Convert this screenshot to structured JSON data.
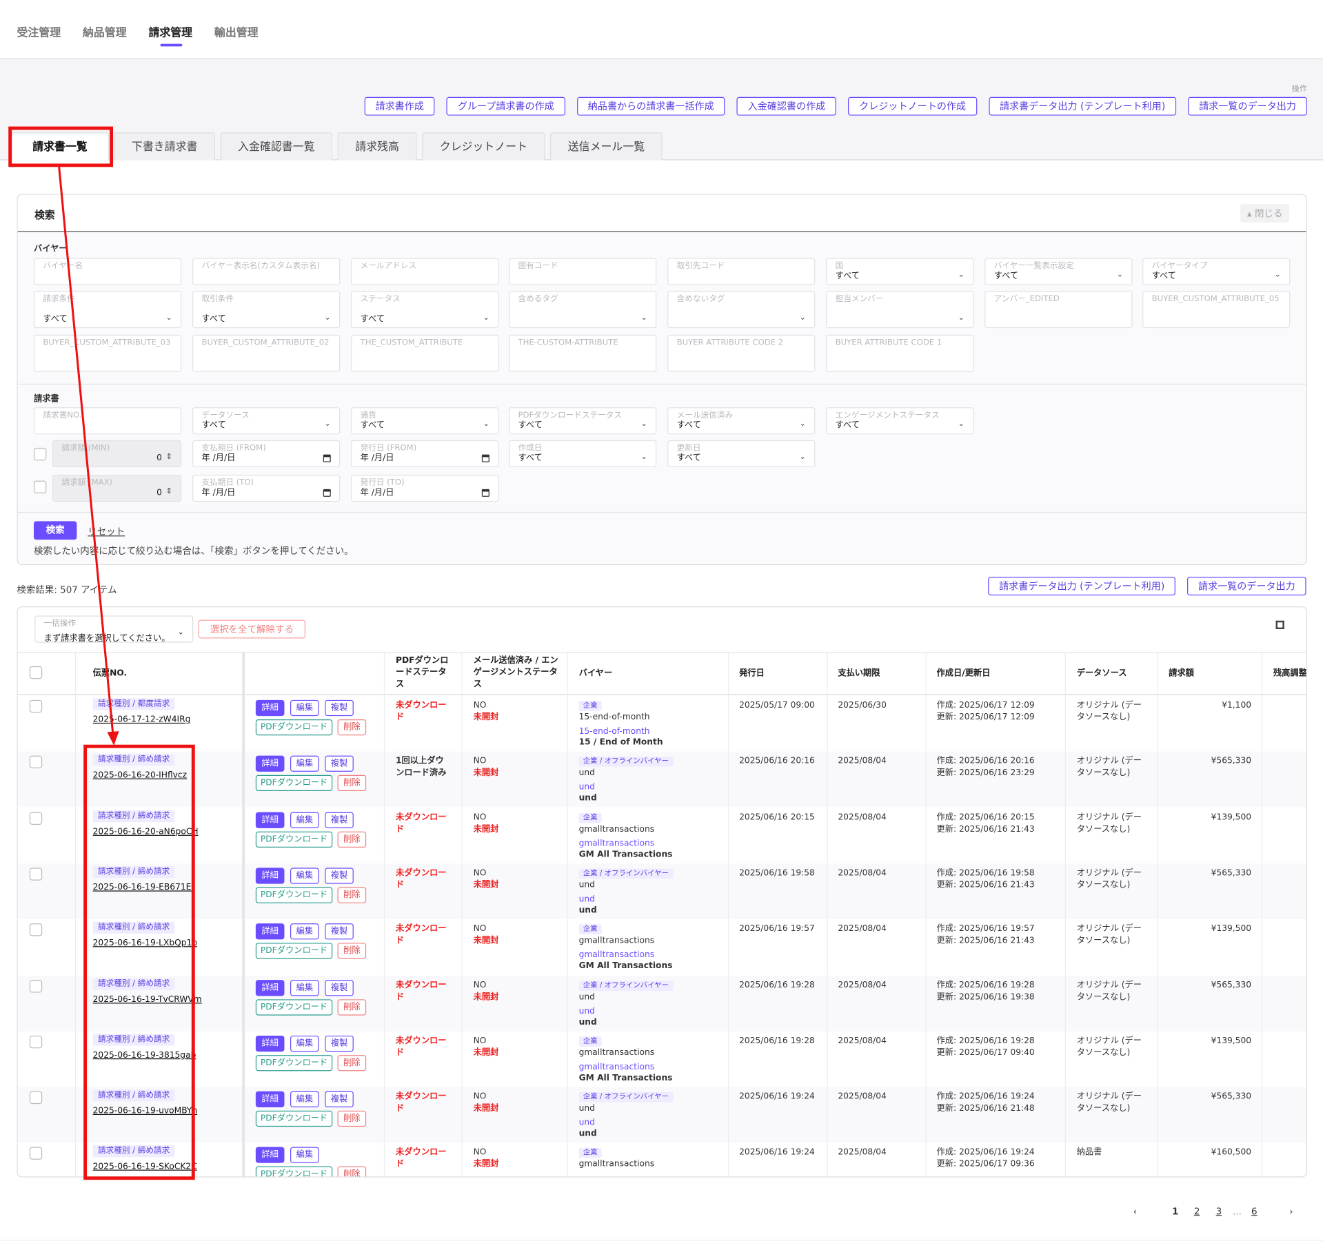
{
  "topnav": [
    "受注管理",
    "納品管理",
    "請求管理",
    "輸出管理"
  ],
  "ops_label": "操作",
  "ops": [
    "請求書作成",
    "グループ請求書の作成",
    "納品書からの請求書一括作成",
    "入金確認書の作成",
    "クレジットノートの作成",
    "請求書データ出力 (テンプレート利用)",
    "請求一覧のデータ出力"
  ],
  "tabs": [
    "請求書一覧",
    "下書き請求書",
    "入金確認書一覧",
    "請求残高",
    "クレジットノート",
    "送信メール一覧"
  ],
  "search": {
    "title": "検索",
    "close": "閉じる",
    "buyer_label": "バイヤー",
    "invoice_label": "請求書",
    "buyer_fields": [
      {
        "label": "バイヤー名",
        "value": ""
      },
      {
        "label": "バイヤー表示名(カスタム表示名)",
        "value": ""
      },
      {
        "label": "メールアドレス",
        "value": ""
      },
      {
        "label": "固有コード",
        "value": ""
      },
      {
        "label": "取引先コード",
        "value": ""
      },
      {
        "label": "国",
        "value": "すべて"
      },
      {
        "label": "バイヤー一覧表示設定",
        "value": "すべて"
      },
      {
        "label": "バイヤータイプ",
        "value": "すべて"
      },
      {
        "label": "請求条件",
        "value": "すべて"
      },
      {
        "label": "取引条件",
        "value": "すべて"
      },
      {
        "label": "ステータス",
        "value": "すべて"
      },
      {
        "label": "含めるタグ",
        "value": ""
      },
      {
        "label": "含めないタグ",
        "value": ""
      },
      {
        "label": "担当メンバー",
        "value": ""
      },
      {
        "label": "アンバー_EDITED",
        "value": ""
      },
      {
        "label": "BUYER_CUSTOM_ATTRIBUTE_05",
        "value": ""
      },
      {
        "label": "BUYER_CUSTOM_ATTRIBUTE_03",
        "value": ""
      },
      {
        "label": "BUYER_CUSTOM_ATTRIBUTE_02",
        "value": ""
      },
      {
        "label": "THE_CUSTOM_ATTRIBUTE",
        "value": ""
      },
      {
        "label": "THE-CUSTOM-ATTRIBUTE",
        "value": ""
      },
      {
        "label": "BUYER ATTRIBUTE CODE 2",
        "value": ""
      },
      {
        "label": "BUYER ATTRIBUTE CODE 1",
        "value": ""
      }
    ],
    "invoice_fields": [
      {
        "label": "請求書NO.",
        "value": ""
      },
      {
        "label": "データソース",
        "value": "すべて"
      },
      {
        "label": "通貨",
        "value": "すべて"
      },
      {
        "label": "PDFダウンロードステータス",
        "value": "すべて"
      },
      {
        "label": "メール送信済み",
        "value": "すべて"
      },
      {
        "label": "エンゲージメントステータス",
        "value": "すべて"
      },
      {
        "label": "請求額 (MIN)",
        "value": "0"
      },
      {
        "label": "支払期日 (FROM)",
        "value": "年 /月/日"
      },
      {
        "label": "発行日 (FROM)",
        "value": "年 /月/日"
      },
      {
        "label": "作成日",
        "value": "すべて"
      },
      {
        "label": "更新日",
        "value": "すべて"
      },
      {
        "label": "請求額 (MAX)",
        "value": "0"
      },
      {
        "label": "支払期日 (TO)",
        "value": "年 /月/日"
      },
      {
        "label": "発行日 (TO)",
        "value": "年 /月/日"
      }
    ],
    "search_btn": "検索",
    "reset": "リセット",
    "hint": "検索したい内容に応じて絞り込む場合は、「検索」ボタンを押してください。"
  },
  "result_count": "検索結果: 507 アイテム",
  "export_buttons": [
    "請求書データ出力 (テンプレート利用)",
    "請求一覧のデータ出力"
  ],
  "bulk": {
    "label": "一括操作",
    "value": "まず請求書を選択してください。",
    "clear": "選択を全て解除する"
  },
  "columns": [
    "伝票NO.",
    "PDFダウンロードステータス",
    "メール送信済み / エンゲージメントステータス",
    "バイヤー",
    "発行日",
    "支払い期限",
    "作成日/更新日",
    "データソース",
    "請求額",
    "残高調整"
  ],
  "action_labels": {
    "detail": "詳細",
    "edit": "編集",
    "copy": "複製",
    "pdf": "PDFダウンロード",
    "delete": "削除"
  },
  "rows": [
    {
      "type": "請求種別 / 都度請求",
      "no": "2025-06-17-12-zW4IRg",
      "pdf": "未ダウンロード",
      "mail": "NO",
      "engage": "未開封",
      "tag": "企業",
      "buyer": "15-end-of-month",
      "buyer_link": "15-end-of-month",
      "buyer_bold": "15 / End of Month",
      "issue": "2025/05/17 09:00",
      "due": "2025/06/30",
      "created": "作成: 2025/06/17 12:09",
      "updated": "更新: 2025/06/17 12:09",
      "source": "オリジナル (データソースなし)",
      "amount": "¥1,100"
    },
    {
      "type": "請求種別 / 締め請求",
      "no": "2025-06-16-20-IHflvcz",
      "pdf": "1回以上ダウンロード済み",
      "mail": "NO",
      "engage": "未開封",
      "tag": "企業 / オフラインバイヤー",
      "buyer": "und",
      "buyer_link": "und",
      "buyer_bold": "und",
      "issue": "2025/06/16 20:16",
      "due": "2025/08/04",
      "created": "作成: 2025/06/16 20:16",
      "updated": "更新: 2025/06/16 23:29",
      "source": "オリジナル (データソースなし)",
      "amount": "¥565,330"
    },
    {
      "type": "請求種別 / 締め請求",
      "no": "2025-06-16-20-aN6poCH",
      "pdf": "未ダウンロード",
      "mail": "NO",
      "engage": "未開封",
      "tag": "企業",
      "buyer": "gmalltransactions",
      "buyer_link": "gmalltransactions",
      "buyer_bold": "GM All Transactions",
      "issue": "2025/06/16 20:15",
      "due": "2025/08/04",
      "created": "作成: 2025/06/16 20:15",
      "updated": "更新: 2025/06/16 21:43",
      "source": "オリジナル (データソースなし)",
      "amount": "¥139,500"
    },
    {
      "type": "請求種別 / 締め請求",
      "no": "2025-06-16-19-EB671Ef",
      "pdf": "未ダウンロード",
      "mail": "NO",
      "engage": "未開封",
      "tag": "企業 / オフラインバイヤー",
      "buyer": "und",
      "buyer_link": "und",
      "buyer_bold": "und",
      "issue": "2025/06/16 19:58",
      "due": "2025/08/04",
      "created": "作成: 2025/06/16 19:58",
      "updated": "更新: 2025/06/16 21:43",
      "source": "オリジナル (データソースなし)",
      "amount": "¥565,330"
    },
    {
      "type": "請求種別 / 締め請求",
      "no": "2025-06-16-19-LXbQp1p",
      "pdf": "未ダウンロード",
      "mail": "NO",
      "engage": "未開封",
      "tag": "企業",
      "buyer": "gmalltransactions",
      "buyer_link": "gmalltransactions",
      "buyer_bold": "GM All Transactions",
      "issue": "2025/06/16 19:57",
      "due": "2025/08/04",
      "created": "作成: 2025/06/16 19:57",
      "updated": "更新: 2025/06/16 21:43",
      "source": "オリジナル (データソースなし)",
      "amount": "¥139,500"
    },
    {
      "type": "請求種別 / 締め請求",
      "no": "2025-06-16-19-TvCRWVm",
      "pdf": "未ダウンロード",
      "mail": "NO",
      "engage": "未開封",
      "tag": "企業 / オフラインバイヤー",
      "buyer": "und",
      "buyer_link": "und",
      "buyer_bold": "und",
      "issue": "2025/06/16 19:28",
      "due": "2025/08/04",
      "created": "作成: 2025/06/16 19:28",
      "updated": "更新: 2025/06/16 19:38",
      "source": "オリジナル (データソースなし)",
      "amount": "¥565,330"
    },
    {
      "type": "請求種別 / 締め請求",
      "no": "2025-06-16-19-3815gab",
      "pdf": "未ダウンロード",
      "mail": "NO",
      "engage": "未開封",
      "tag": "企業",
      "buyer": "gmalltransactions",
      "buyer_link": "gmalltransactions",
      "buyer_bold": "GM All Transactions",
      "issue": "2025/06/16 19:28",
      "due": "2025/08/04",
      "created": "作成: 2025/06/16 19:28",
      "updated": "更新: 2025/06/17 09:40",
      "source": "オリジナル (データソースなし)",
      "amount": "¥139,500"
    },
    {
      "type": "請求種別 / 締め請求",
      "no": "2025-06-16-19-uvoMBYh",
      "pdf": "未ダウンロード",
      "mail": "NO",
      "engage": "未開封",
      "tag": "企業 / オフラインバイヤー",
      "buyer": "und",
      "buyer_link": "und",
      "buyer_bold": "und",
      "issue": "2025/06/16 19:24",
      "due": "2025/08/04",
      "created": "作成: 2025/06/16 19:24",
      "updated": "更新: 2025/06/16 21:48",
      "source": "オリジナル (データソースなし)",
      "amount": "¥565,330"
    },
    {
      "type": "請求種別 / 締め請求",
      "no": "2025-06-16-19-SKoCK2C",
      "pdf": "未ダウンロード",
      "mail": "NO",
      "engage": "未開封",
      "tag": "企業",
      "buyer": "gmalltransactions",
      "buyer_link": "",
      "buyer_bold": "",
      "issue": "2025/06/16 19:24",
      "due": "2025/08/04",
      "created": "作成: 2025/06/16 19:24",
      "updated": "更新: 2025/06/17 09:36",
      "source": "納品書",
      "amount": "¥160,500"
    }
  ],
  "pager": {
    "prev": "‹",
    "pages": [
      "1",
      "2",
      "3"
    ],
    "ellipsis": "...",
    "last": "6",
    "next": "›"
  },
  "colors": {
    "accent": "#6b4cff",
    "highlight": "#ee1111"
  }
}
